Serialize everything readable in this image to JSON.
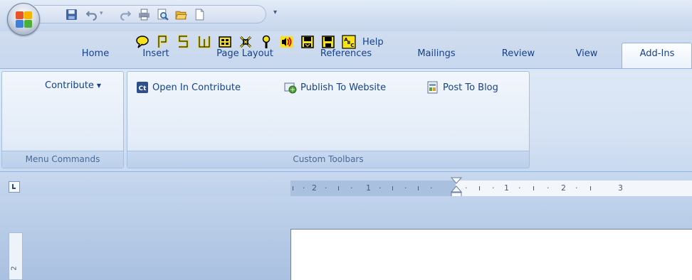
{
  "quick_access": {
    "icons": [
      "save-icon",
      "undo-icon",
      "redo-icon",
      "print-icon",
      "print-preview-icon",
      "open-icon",
      "new-document-icon"
    ],
    "customize_arrow": "▾"
  },
  "tabs": [
    {
      "label": "Home"
    },
    {
      "label": "Insert"
    },
    {
      "label": "Page Layout"
    },
    {
      "label": "References"
    },
    {
      "label": "Mailings"
    },
    {
      "label": "Review"
    },
    {
      "label": "View"
    },
    {
      "label": "Add-Ins"
    }
  ],
  "active_tab": "Add-Ins",
  "groups": {
    "menu_commands": {
      "label": "Menu Commands",
      "dropdown_label": "Contribute",
      "dropdown_arrow": "▼"
    },
    "custom_toolbars": {
      "label": "Custom Toolbars",
      "buttons": [
        {
          "label": "Open In Contribute",
          "icon": "contribute-icon"
        },
        {
          "label": "Publish To Website",
          "icon": "publish-website-icon"
        },
        {
          "label": "Post To Blog",
          "icon": "post-blog-icon"
        }
      ],
      "tool_icons": [
        "comment-balloon-icon",
        "p-icon",
        "five-icon",
        "w-icon",
        "grid-icon",
        "crossed-tools-icon",
        "key-icon",
        "audio-icon",
        "save-alt-icon",
        "disk-icon",
        "abc-icon"
      ],
      "help_label": "Help"
    }
  },
  "ruler": {
    "ticks": [
      "ı",
      "·",
      "2",
      "·",
      "ı",
      "·",
      "1",
      "·",
      "ı",
      "·",
      "ı",
      "·",
      "1",
      "·",
      "ı",
      "·",
      "2",
      "·",
      "ı",
      "·",
      "3",
      "·",
      "ı"
    ]
  },
  "vertical_ruler": {
    "tick": "2"
  },
  "colors": {
    "ribbon_text": "#15428b",
    "accent": "#8db2e3"
  }
}
